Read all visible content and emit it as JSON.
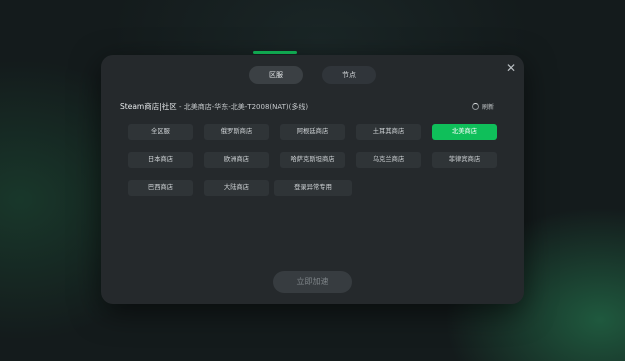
{
  "tabs": [
    {
      "label": "区服"
    },
    {
      "label": "节点"
    }
  ],
  "route": {
    "game": "Steam商店|社区",
    "sub": " - 北美商店-华东-北美-T2008(NAT)(多线)"
  },
  "refresh": {
    "label": "刷新"
  },
  "regions": [
    {
      "label": "全区服",
      "active": false
    },
    {
      "label": "俄罗斯商店",
      "active": false
    },
    {
      "label": "阿根廷商店",
      "active": false
    },
    {
      "label": "土耳其商店",
      "active": false
    },
    {
      "label": "北美商店",
      "active": true
    },
    {
      "label": "日本商店",
      "active": false
    },
    {
      "label": "欧洲商店",
      "active": false
    },
    {
      "label": "哈萨克斯坦商店",
      "active": false
    },
    {
      "label": "乌克兰商店",
      "active": false
    },
    {
      "label": "菲律宾商店",
      "active": false
    },
    {
      "label": "巴西商店",
      "active": false
    },
    {
      "label": "大陆商店",
      "active": false
    },
    {
      "label": "登录异常专用",
      "active": false
    }
  ],
  "action": {
    "label": "立即加速"
  },
  "colors": {
    "accent": "#13c05c",
    "panel": "#25292c",
    "chip": "#2f3437"
  }
}
